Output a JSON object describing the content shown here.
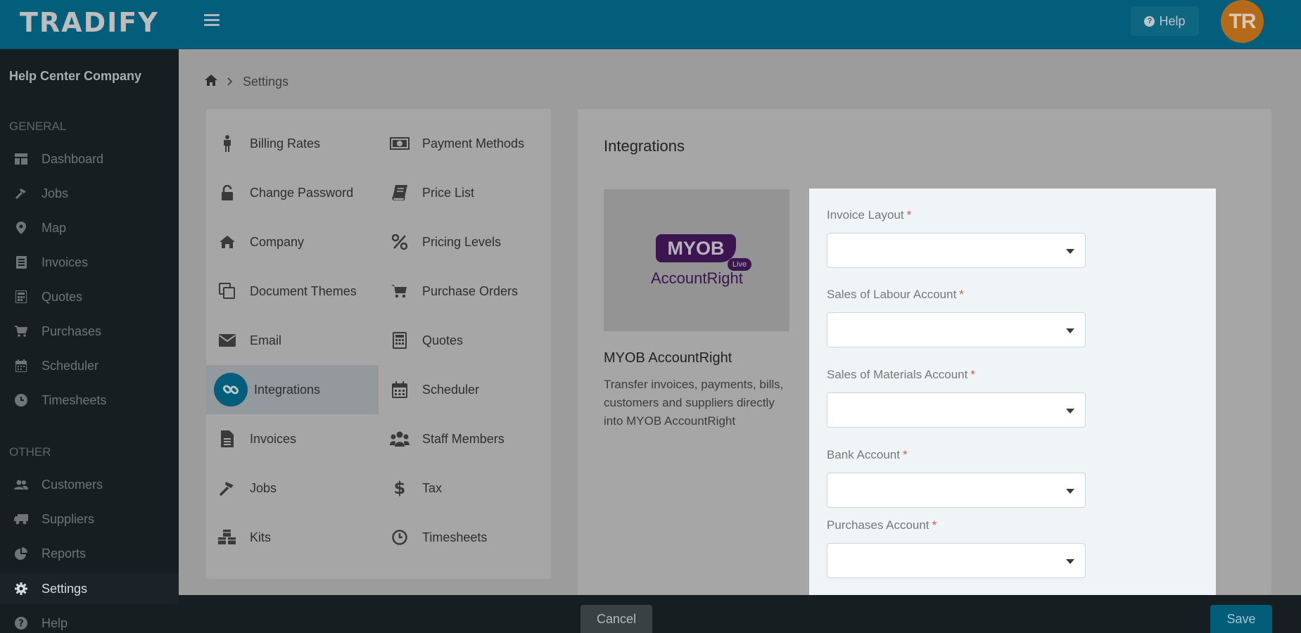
{
  "app": {
    "logo": "TRADIFY",
    "help_label": "Help",
    "avatar_initials": "TR"
  },
  "sidebar": {
    "company": "Help Center Company",
    "general_label": "GENERAL",
    "other_label": "OTHER",
    "general_items": [
      {
        "label": "Dashboard",
        "icon": "dashboard-icon"
      },
      {
        "label": "Jobs",
        "icon": "hammer-icon"
      },
      {
        "label": "Map",
        "icon": "map-pin-icon"
      },
      {
        "label": "Invoices",
        "icon": "invoice-icon"
      },
      {
        "label": "Quotes",
        "icon": "calculator-icon"
      },
      {
        "label": "Purchases",
        "icon": "cart-icon"
      },
      {
        "label": "Scheduler",
        "icon": "calendar-icon"
      },
      {
        "label": "Timesheets",
        "icon": "clock-icon"
      }
    ],
    "other_items": [
      {
        "label": "Customers",
        "icon": "users-icon"
      },
      {
        "label": "Suppliers",
        "icon": "truck-icon"
      },
      {
        "label": "Reports",
        "icon": "pie-chart-icon"
      },
      {
        "label": "Settings",
        "icon": "gear-icon"
      },
      {
        "label": "Help",
        "icon": "help-circle-icon"
      }
    ],
    "active": "Settings"
  },
  "breadcrumb": {
    "current": "Settings"
  },
  "settings_menu": {
    "left": [
      {
        "label": "Billing Rates",
        "icon": "person-icon"
      },
      {
        "label": "Change Password",
        "icon": "unlock-icon"
      },
      {
        "label": "Company",
        "icon": "home-icon"
      },
      {
        "label": "Document Themes",
        "icon": "copy-icon"
      },
      {
        "label": "Email",
        "icon": "envelope-icon"
      },
      {
        "label": "Integrations",
        "icon": "link-icon"
      },
      {
        "label": "Invoices",
        "icon": "file-text-icon"
      },
      {
        "label": "Jobs",
        "icon": "hammer-icon"
      },
      {
        "label": "Kits",
        "icon": "cubes-icon"
      }
    ],
    "right": [
      {
        "label": "Payment Methods",
        "icon": "money-icon"
      },
      {
        "label": "Price List",
        "icon": "book-icon"
      },
      {
        "label": "Pricing Levels",
        "icon": "percent-icon"
      },
      {
        "label": "Purchase Orders",
        "icon": "cart-icon"
      },
      {
        "label": "Quotes",
        "icon": "calculator-icon"
      },
      {
        "label": "Scheduler",
        "icon": "calendar-icon"
      },
      {
        "label": "Staff Members",
        "icon": "users-icon"
      },
      {
        "label": "Tax",
        "icon": "dollar-icon"
      },
      {
        "label": "Timesheets",
        "icon": "clock-icon"
      }
    ],
    "active": "Integrations"
  },
  "integrations": {
    "title": "Integrations",
    "logo_mark": "MYOB",
    "logo_live": "Live",
    "logo_product": "AccountRight",
    "product_name": "MYOB AccountRight",
    "description": "Transfer invoices, payments, bills, customers and suppliers directly into MYOB AccountRight",
    "fields": [
      {
        "label": "Invoice Layout",
        "value": ""
      },
      {
        "label": "Sales of Labour Account",
        "value": ""
      },
      {
        "label": "Sales of Materials Account",
        "value": ""
      },
      {
        "label": "Bank Account",
        "value": ""
      },
      {
        "label": "Purchases Account",
        "value": ""
      }
    ],
    "required_marker": "*"
  },
  "footer": {
    "cancel_label": "Cancel",
    "save_label": "Save"
  },
  "colors": {
    "topbar": "#025e7b",
    "sidebar": "#171e22",
    "accent": "#025e7b",
    "required": "#d9534f"
  }
}
